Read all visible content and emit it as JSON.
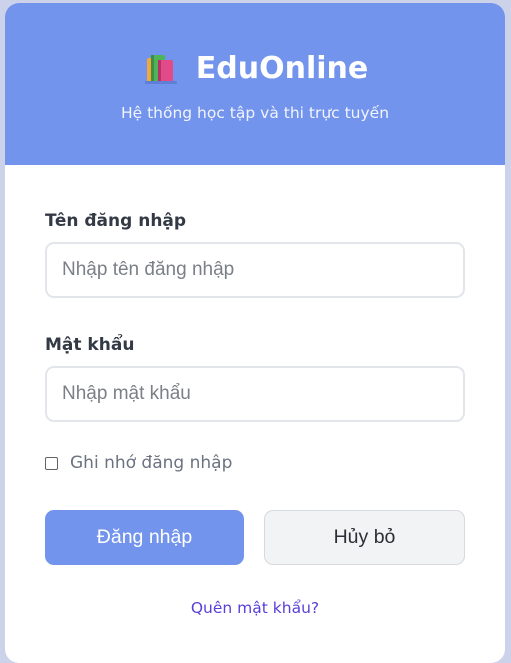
{
  "header": {
    "brand_icon": "books-icon",
    "brand_name": "EduOnline",
    "tagline": "Hệ thống học tập và thi trực tuyến"
  },
  "form": {
    "username": {
      "label": "Tên đăng nhập",
      "placeholder": "Nhập tên đăng nhập",
      "value": ""
    },
    "password": {
      "label": "Mật khẩu",
      "placeholder": "Nhập mật khẩu",
      "value": ""
    },
    "remember": {
      "label": "Ghi nhớ đăng nhập",
      "checked": false
    },
    "login_label": "Đăng nhập",
    "cancel_label": "Hủy bỏ",
    "forgot_label": "Quên mật khẩu?"
  },
  "colors": {
    "primary": "#7394ec",
    "link": "#5a3fd6",
    "page_background": "#ccd2ea"
  }
}
